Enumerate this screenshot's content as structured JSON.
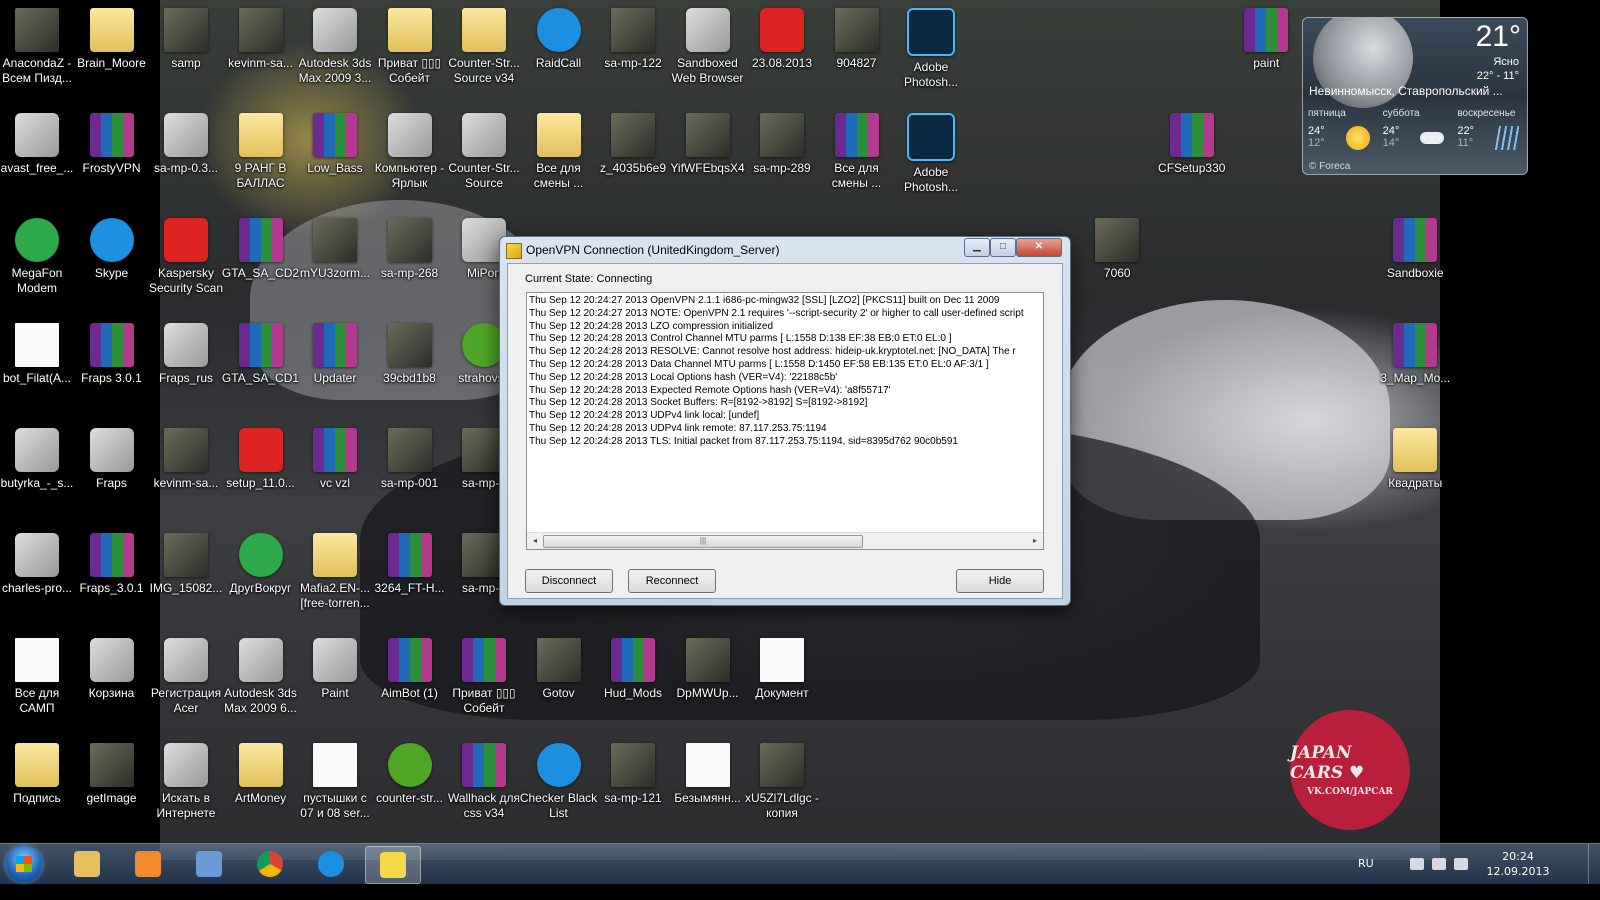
{
  "desktop": {
    "icons": [
      {
        "label": "AnacondaZ - Всем Пизд...",
        "type": "photo"
      },
      {
        "label": "Brain_Moore",
        "type": "folder"
      },
      {
        "label": "samp",
        "type": "photo"
      },
      {
        "label": "kevinm-sa...",
        "type": "photo"
      },
      {
        "label": "Autodesk 3ds Max 2009 3...",
        "type": "exe"
      },
      {
        "label": "Приват ▯▯▯ Собейт",
        "type": "folder"
      },
      {
        "label": "Counter-Str... Source v34",
        "type": "folder"
      },
      {
        "label": "RaidCall",
        "type": "blue"
      },
      {
        "label": "sa-mp-122",
        "type": "photo"
      },
      {
        "label": "Sandboxed Web Browser",
        "type": "exe"
      },
      {
        "label": "23.08.2013",
        "type": "red"
      },
      {
        "label": "904827",
        "type": "photo"
      },
      {
        "label": "Adobe Photosh...",
        "type": "ps"
      },
      {
        "label": "paint",
        "type": "winrar"
      },
      {
        "label": "avast_free_...",
        "type": "exe"
      },
      {
        "label": "FrostyVPN",
        "type": "winrar"
      },
      {
        "label": "sa-mp-0.3...",
        "type": "exe"
      },
      {
        "label": "9 РАНГ В БАЛЛАС",
        "type": "folder"
      },
      {
        "label": "Low_Bass",
        "type": "winrar"
      },
      {
        "label": "Компьютер - Ярлык",
        "type": "exe"
      },
      {
        "label": "Counter-Str... Source",
        "type": "exe"
      },
      {
        "label": "Все для смены ...",
        "type": "folder"
      },
      {
        "label": "z_4035b6e9",
        "type": "photo"
      },
      {
        "label": "YifWFEbqsX4",
        "type": "photo"
      },
      {
        "label": "sa-mp-289",
        "type": "photo"
      },
      {
        "label": "Все для смены ...",
        "type": "winrar"
      },
      {
        "label": "Adobe Photosh...",
        "type": "ps"
      },
      {
        "label": "CFSetup330",
        "type": "winrar"
      },
      {
        "label": "MegaFon Modem",
        "type": "green"
      },
      {
        "label": "Skype",
        "type": "blue"
      },
      {
        "label": "Kaspersky Security Scan",
        "type": "red"
      },
      {
        "label": "GTA_SA_CD2",
        "type": "winrar"
      },
      {
        "label": "mYU3zorm...",
        "type": "photo"
      },
      {
        "label": "sa-mp-268",
        "type": "photo"
      },
      {
        "label": "MiPon",
        "type": "exe"
      },
      {
        "label": "7060",
        "type": "photo"
      },
      {
        "label": "Sandboxie",
        "type": "winrar"
      },
      {
        "label": "bot_Filat(A...",
        "type": "doc"
      },
      {
        "label": "Fraps 3.0.1",
        "type": "winrar"
      },
      {
        "label": "Fraps_rus",
        "type": "exe"
      },
      {
        "label": "GTA_SA_CD1",
        "type": "winrar"
      },
      {
        "label": "Updater",
        "type": "winrar"
      },
      {
        "label": "39cbd1b8",
        "type": "photo"
      },
      {
        "label": "strahovsc",
        "type": "utorrent"
      },
      {
        "label": "3_Map_Mo...",
        "type": "winrar"
      },
      {
        "label": "butyrka_-_s...",
        "type": "exe"
      },
      {
        "label": "Fraps",
        "type": "exe"
      },
      {
        "label": "kevinm-sa...",
        "type": "photo"
      },
      {
        "label": "setup_11.0...",
        "type": "red"
      },
      {
        "label": "vc vzl",
        "type": "winrar"
      },
      {
        "label": "sa-mp-001",
        "type": "photo"
      },
      {
        "label": "sa-mp-0",
        "type": "photo"
      },
      {
        "label": "Квадраты",
        "type": "folder"
      },
      {
        "label": "charles-pro...",
        "type": "exe"
      },
      {
        "label": "Fraps_3.0.1",
        "type": "winrar"
      },
      {
        "label": "IMG_15082...",
        "type": "photo"
      },
      {
        "label": "ДругВокруг",
        "type": "green"
      },
      {
        "label": "Mafia2.EN-... [free-torren...",
        "type": "folder"
      },
      {
        "label": "3264_FT-H...",
        "type": "winrar"
      },
      {
        "label": "sa-mp-1",
        "type": "photo"
      },
      {
        "label": "Все для САМП",
        "type": "doc"
      },
      {
        "label": "Корзина",
        "type": "exe"
      },
      {
        "label": "Регистрация Acer",
        "type": "exe"
      },
      {
        "label": "Autodesk 3ds Max 2009 6...",
        "type": "exe"
      },
      {
        "label": "Paint",
        "type": "exe"
      },
      {
        "label": "AimBot (1)",
        "type": "winrar"
      },
      {
        "label": "Приват ▯▯▯ Собейт",
        "type": "winrar"
      },
      {
        "label": "Gotov",
        "type": "photo"
      },
      {
        "label": "Hud_Mods",
        "type": "winrar"
      },
      {
        "label": "DpMWUp...",
        "type": "photo"
      },
      {
        "label": "Документ",
        "type": "doc"
      },
      {
        "label": "Подпись",
        "type": "folder"
      },
      {
        "label": "getImage",
        "type": "photo"
      },
      {
        "label": "Искать в Интернете",
        "type": "exe"
      },
      {
        "label": "ArtMoney",
        "type": "folder"
      },
      {
        "label": "пустышки с 07 и 08 ser...",
        "type": "doc"
      },
      {
        "label": "counter-str...",
        "type": "utorrent"
      },
      {
        "label": "Wallhack для css v34",
        "type": "winrar"
      },
      {
        "label": "Checker Black List",
        "type": "blue"
      },
      {
        "label": "sa-mp-121",
        "type": "photo"
      },
      {
        "label": "Безымянн...",
        "type": "doc"
      },
      {
        "label": "xU5Zl7Ldlgc - копия",
        "type": "photo"
      }
    ],
    "wallpaper_badge": {
      "title": "JAPAN CARS ♥",
      "subtitle": "VK.COM/JAPCAR"
    }
  },
  "weather": {
    "temp": "21°",
    "condition": "Ясно",
    "range": "22° - 11°",
    "city": "Невинномысск, Ставропольский ...",
    "days": [
      {
        "name": "пятница",
        "hi": "24°",
        "lo": "12°",
        "icon": "sun-icon"
      },
      {
        "name": "суббота",
        "hi": "24°",
        "lo": "14°",
        "icon": "cloud-icon"
      },
      {
        "name": "воскресенье",
        "hi": "22°",
        "lo": "11°",
        "icon": "rain-icon"
      }
    ],
    "credit": "© Foreca"
  },
  "vpn": {
    "title": "OpenVPN Connection (UnitedKingdom_Server)",
    "state": "Current State: Connecting",
    "log": [
      "Thu Sep 12 20:24:27 2013 OpenVPN 2.1.1 i686-pc-mingw32 [SSL] [LZO2] [PKCS11] built on Dec 11 2009",
      "Thu Sep 12 20:24:27 2013 NOTE: OpenVPN 2.1 requires '--script-security 2' or higher to call user-defined script",
      "Thu Sep 12 20:24:28 2013 LZO compression initialized",
      "Thu Sep 12 20:24:28 2013 Control Channel MTU parms [ L:1558 D:138 EF:38 EB:0 ET:0 EL:0 ]",
      "Thu Sep 12 20:24:28 2013 RESOLVE: Cannot resolve host address: hideip-uk.kryptotel.net: [NO_DATA] The r",
      "Thu Sep 12 20:24:28 2013 Data Channel MTU parms [ L:1558 D:1450 EF:58 EB:135 ET:0 EL:0 AF:3/1 ]",
      "Thu Sep 12 20:24:28 2013 Local Options hash (VER=V4): '22188c5b'",
      "Thu Sep 12 20:24:28 2013 Expected Remote Options hash (VER=V4): 'a8f55717'",
      "Thu Sep 12 20:24:28 2013 Socket Buffers: R=[8192->8192] S=[8192->8192]",
      "Thu Sep 12 20:24:28 2013 UDPv4 link local: [undef]",
      "Thu Sep 12 20:24:28 2013 UDPv4 link remote: 87.117.253.75:1194",
      "Thu Sep 12 20:24:28 2013 TLS: Initial packet from 87.117.253.75:1194, sid=8395d762 90c0b591"
    ],
    "buttons": {
      "disconnect": "Disconnect",
      "reconnect": "Reconnect",
      "hide": "Hide"
    },
    "window_buttons": {
      "min": "▁",
      "max": "□",
      "close": "✕"
    },
    "scroll": {
      "left": "◂",
      "right": "▸",
      "thumb": "|||"
    }
  },
  "taskbar": {
    "apps": [
      {
        "name": "explorer-icon",
        "color": "#e6c060"
      },
      {
        "name": "media-player-icon",
        "color": "#f08a2a"
      },
      {
        "name": "tools-icon",
        "color": "#6a9ad8"
      },
      {
        "name": "chrome-icon",
        "color": "#db4437"
      },
      {
        "name": "skype-icon",
        "color": "#1d8fe0"
      },
      {
        "name": "openvpn-icon",
        "color": "#f5d94a"
      }
    ],
    "lang": "RU",
    "time": "20:24",
    "date": "12.09.2013"
  }
}
